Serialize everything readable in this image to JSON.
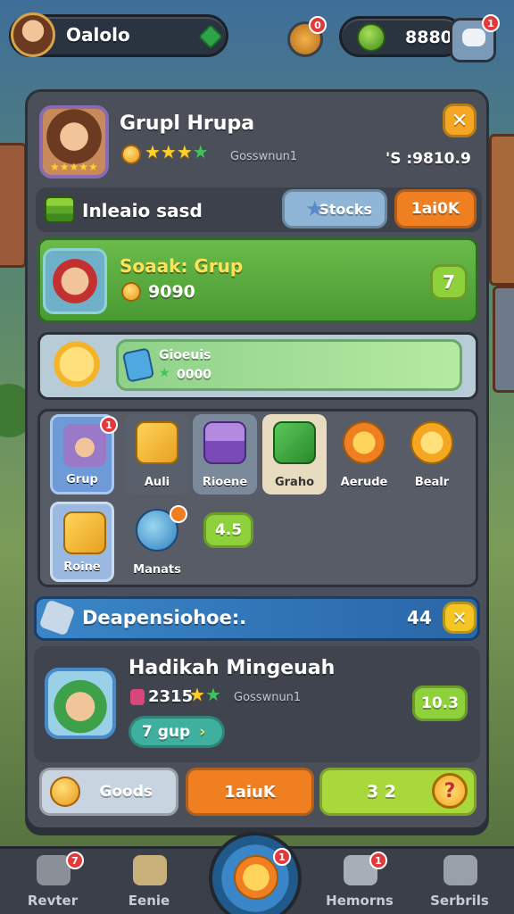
{
  "topbar": {
    "player_name": "Oalolo",
    "currency_value": "8880",
    "sword_badge": "0",
    "chat_badge": "1"
  },
  "profile": {
    "name": "Grupl Hrupa",
    "status_text": "Gosswnun1",
    "score": "'S :9810.9"
  },
  "info_row": {
    "label": "Inleaio sasd",
    "stocks_button": "Stocks",
    "orange_button": "1ai0K"
  },
  "group_row": {
    "title": "Soaak: Grup",
    "coins": "9090",
    "count_button": "7"
  },
  "progress_row": {
    "label": "Gioeuis",
    "value": "0000"
  },
  "tiles": [
    {
      "label": "Grup",
      "badge": "1"
    },
    {
      "label": "Auli"
    },
    {
      "label": "Rioene"
    },
    {
      "label": "Graho"
    },
    {
      "label": "Aerude"
    },
    {
      "label": "Bealr"
    },
    {
      "label": "Roine"
    },
    {
      "label": "Manats"
    }
  ],
  "tiles_value_button": "4.5",
  "banner": {
    "title": "Deapensiohoe:.",
    "count": "44"
  },
  "reward": {
    "title": "Hadikah Mingeuah",
    "points": "2315",
    "status_text": "Gosswnun1",
    "group_button": "7 gup",
    "value_button": "10.3"
  },
  "actions": {
    "goods_button": "Goods",
    "orange_button": "1aiuK",
    "green_button": "3 2"
  },
  "nav": [
    {
      "label": "Revter",
      "badge": "7"
    },
    {
      "label": "Eenie"
    },
    {
      "label": "",
      "badge": "1"
    },
    {
      "label": "Hemorns",
      "badge": "1"
    },
    {
      "label": "Serbrils"
    }
  ],
  "colors": {
    "accent_orange": "#f07f22",
    "accent_green": "#8fd13a",
    "accent_blue": "#2f7dc0",
    "panel": "#4a4f5a"
  }
}
